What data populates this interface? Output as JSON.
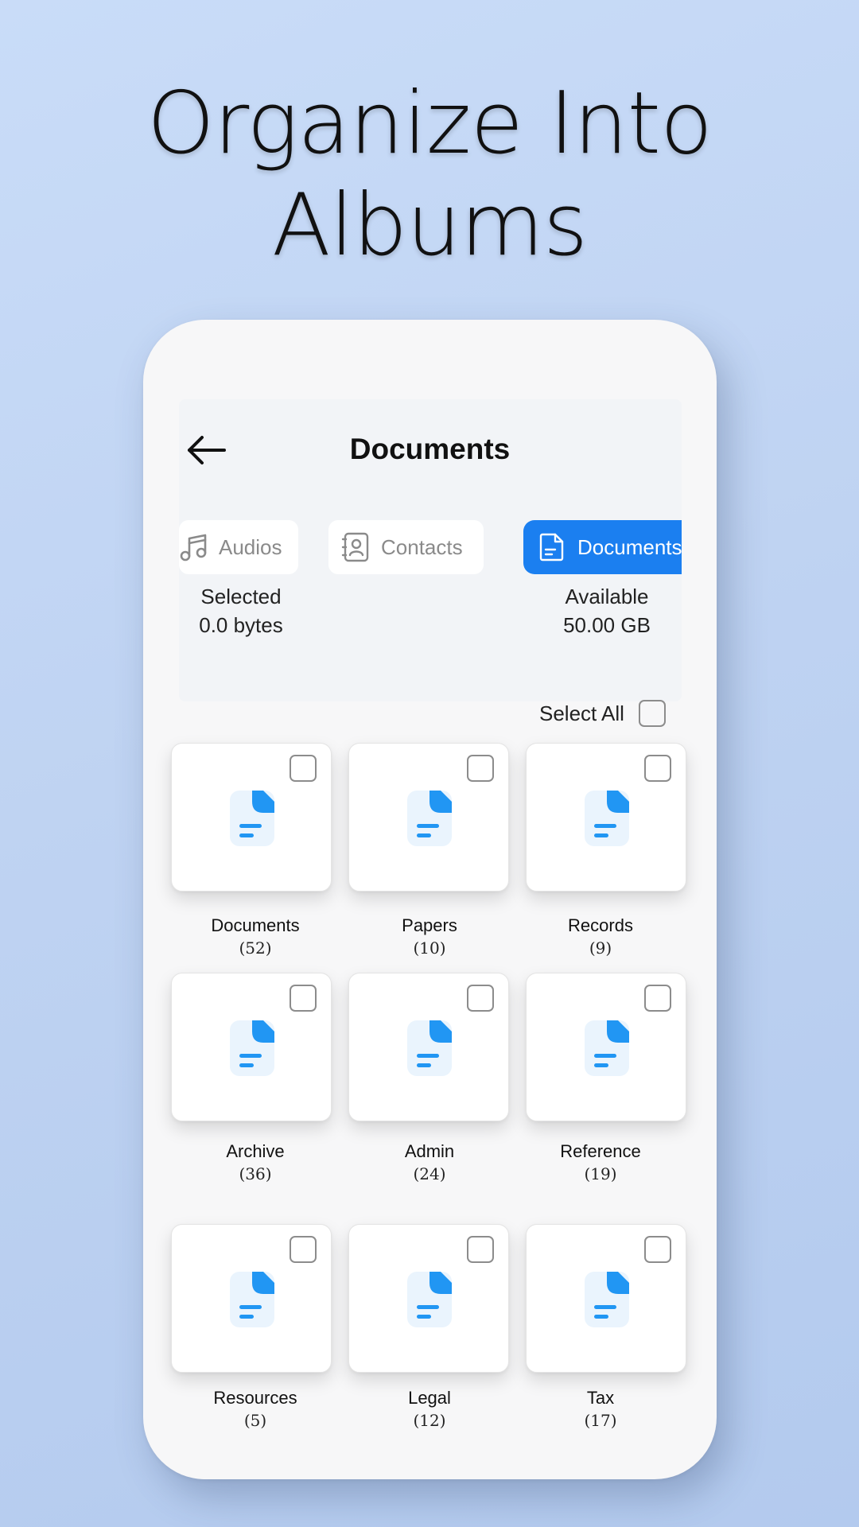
{
  "headline": {
    "line1": "Organize Into",
    "line2": "Albums"
  },
  "screen": {
    "title": "Documents",
    "back_icon": "arrow-left-icon"
  },
  "tabs": [
    {
      "label": "Audios",
      "icon": "music-note-icon",
      "active": false
    },
    {
      "label": "Contacts",
      "icon": "contact-card-icon",
      "active": false
    },
    {
      "label": "Documents",
      "icon": "document-icon",
      "active": true
    }
  ],
  "storage": {
    "selected_label": "Selected",
    "selected_value": "0.0 bytes",
    "available_label": "Available",
    "available_value": "50.00 GB"
  },
  "select_all": {
    "label": "Select All",
    "checked": false
  },
  "albums": [
    {
      "name": "Documents",
      "count": "(52)"
    },
    {
      "name": "Papers",
      "count": "(10)"
    },
    {
      "name": "Records",
      "count": "(9)"
    },
    {
      "name": "Archive",
      "count": "(36)"
    },
    {
      "name": "Admin",
      "count": "(24)"
    },
    {
      "name": "Reference",
      "count": "(19)"
    },
    {
      "name": "Resources",
      "count": "(5)"
    },
    {
      "name": "Legal",
      "count": "(12)"
    },
    {
      "name": "Tax",
      "count": "(17)"
    }
  ],
  "colors": {
    "accent": "#1B7FF0",
    "doc_icon_light": "#EAF4FD",
    "doc_icon_blue": "#2196F3"
  }
}
